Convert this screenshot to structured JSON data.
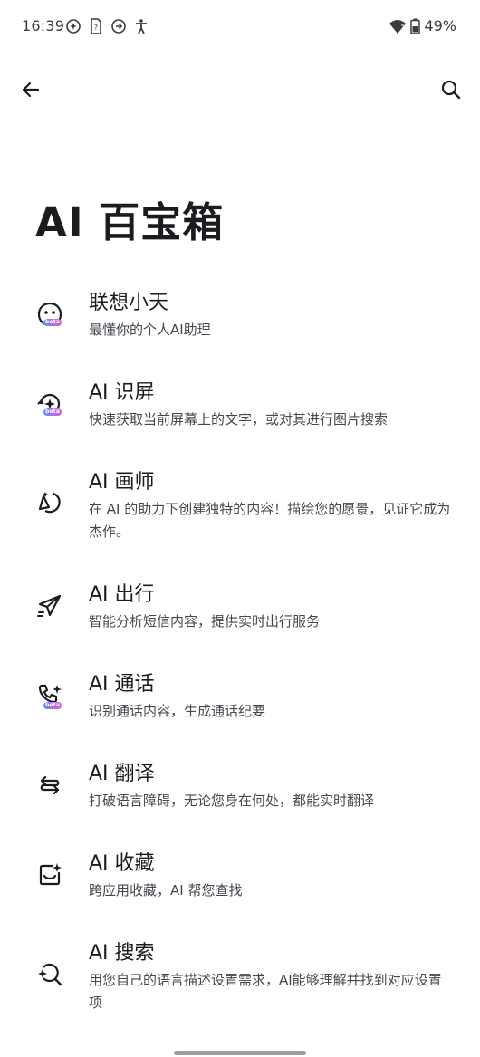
{
  "status_bar": {
    "time": "16:39",
    "battery": "49%",
    "icons": [
      "notification-icon",
      "sim-icon",
      "navigation-icon",
      "accessibility-icon",
      "wifi-icon",
      "battery-icon"
    ]
  },
  "header": {
    "back_icon": "back-arrow-icon",
    "search_icon": "search-icon"
  },
  "page": {
    "title": "AI 百宝箱"
  },
  "tools": [
    {
      "title": "联想小天",
      "desc": "最懂你的个人AI助理",
      "icon": "ai-assistant-face-icon",
      "beta": "beta"
    },
    {
      "title": "AI 识屏",
      "desc": "快速获取当前屏幕上的文字，或对其进行图片搜索",
      "icon": "screen-recognition-icon",
      "beta": "beta"
    },
    {
      "title": "AI 画师",
      "desc": "在 AI 的助力下创建独特的内容！描绘您的愿景，见证它成为杰作。",
      "icon": "ai-painter-icon",
      "beta": ""
    },
    {
      "title": "AI 出行",
      "desc": "智能分析短信内容，提供实时出行服务",
      "icon": "travel-paper-plane-icon",
      "beta": ""
    },
    {
      "title": "AI 通话",
      "desc": "识别通话内容，生成通话纪要",
      "icon": "phone-sparkle-icon",
      "beta": "beta"
    },
    {
      "title": "AI 翻译",
      "desc": "打破语言障碍，无论您身在何处，都能实时翻译",
      "icon": "translate-icon",
      "beta": ""
    },
    {
      "title": "AI 收藏",
      "desc": "跨应用收藏，AI 帮您查找",
      "icon": "collection-icon",
      "beta": ""
    },
    {
      "title": "AI 搜索",
      "desc": "用您自己的语言描述设置需求，AI能够理解并找到对应设置项",
      "icon": "ai-search-icon",
      "beta": ""
    }
  ],
  "colors": {
    "background": "#ffffff",
    "title_text": "#1c1b1f",
    "desc_text": "#49454f",
    "beta_gradient_start": "#6a8cff",
    "beta_gradient_end": "#e05ad8"
  }
}
